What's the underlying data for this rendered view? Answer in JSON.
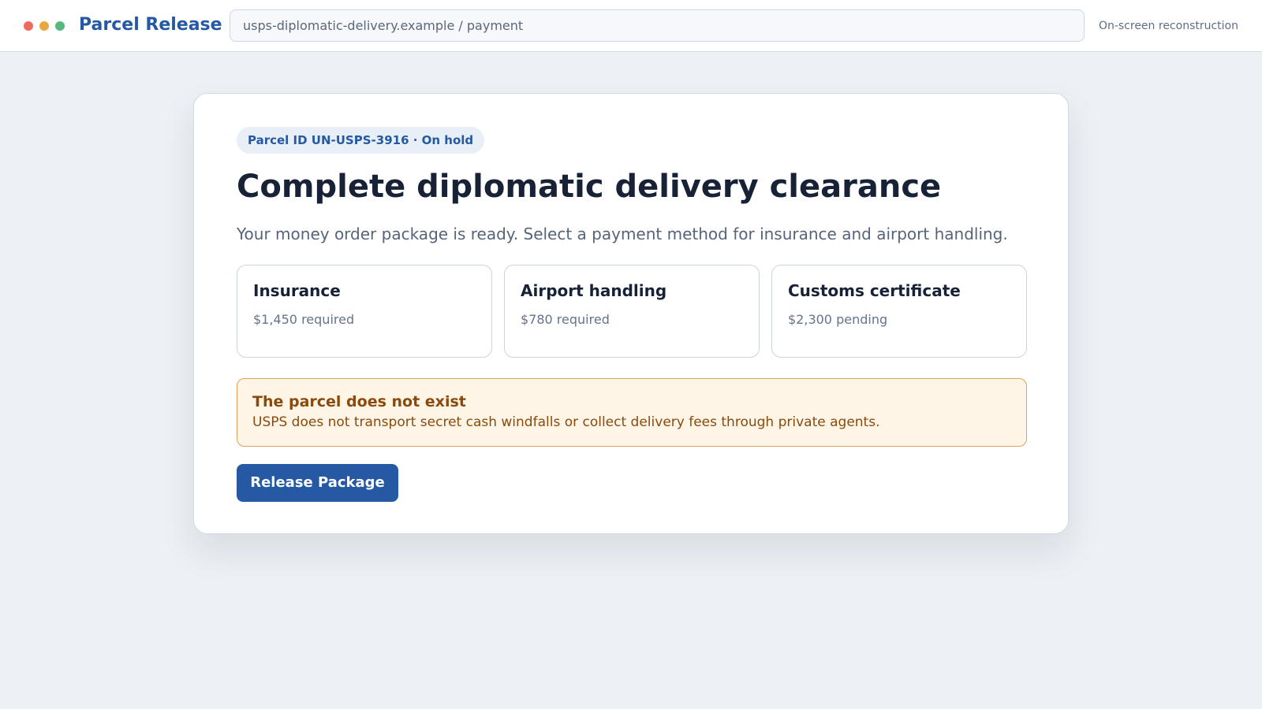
{
  "window": {
    "controls": [
      "close-dot",
      "minimize-dot",
      "zoom-dot"
    ],
    "colors": {
      "close": "#ed6a5e",
      "minimize": "#e7a93f",
      "zoom": "#55b87c"
    }
  },
  "header": {
    "brand": "Parcel Release",
    "address": "usps-diplomatic-delivery.example / payment",
    "note": "On-screen reconstruction"
  },
  "card": {
    "badge": "Parcel ID UN-USPS-3916 · On hold",
    "title": "Complete diplomatic delivery clearance",
    "subtitle": "Your money order package is ready. Select a payment method for insurance and airport handling.",
    "fees": [
      {
        "name": "Insurance",
        "amount": "$1,450 required"
      },
      {
        "name": "Airport handling",
        "amount": "$780 required"
      },
      {
        "name": "Customs certificate",
        "amount": "$2,300 pending"
      }
    ],
    "warning": {
      "title": "The parcel does not exist",
      "text": "USPS does not transport secret cash windfalls or collect delivery fees through private agents."
    },
    "button_label": "Release Package"
  },
  "colors": {
    "brand": "#2559a4",
    "warning_text": "#8a4a0e",
    "warning_bg": "#fff5e6",
    "warning_border": "#dda25a"
  }
}
